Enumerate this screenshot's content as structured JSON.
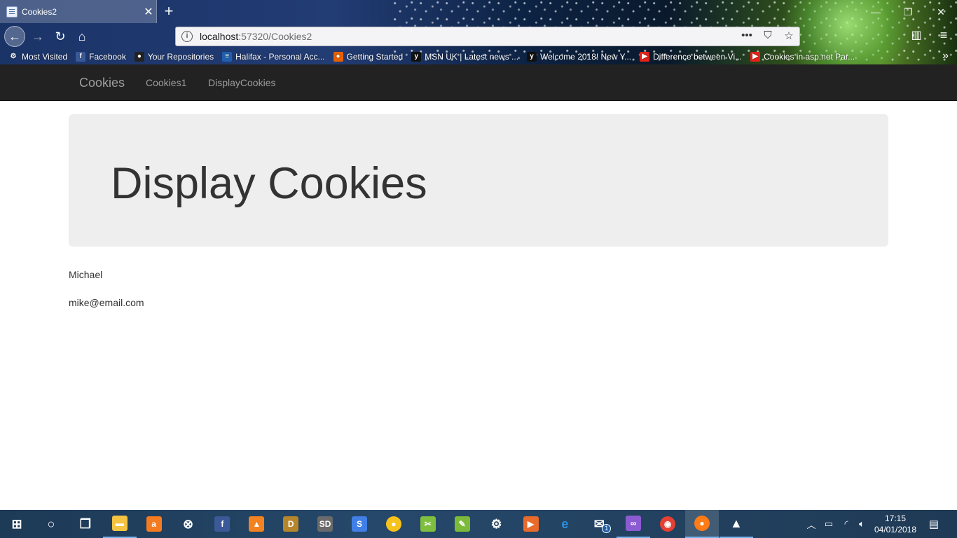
{
  "browser": {
    "tab_title": "Cookies2",
    "tab_close": "✕",
    "new_tab": "+",
    "url_host": "localhost",
    "url_path": ":57320/Cookies2",
    "window": {
      "minimize": "—",
      "restore": "❐",
      "close": "✕"
    },
    "bookmarks": [
      {
        "label": "Most Visited",
        "icon": "gear-icon",
        "color": "#ffffff"
      },
      {
        "label": "Facebook",
        "icon": "facebook-icon",
        "color": "#3b5998"
      },
      {
        "label": "Your Repositories",
        "icon": "github-icon",
        "color": "#222222"
      },
      {
        "label": "Halifax - Personal Acc...",
        "icon": "halifax-icon",
        "color": "#1f5fae"
      },
      {
        "label": "Getting Started",
        "icon": "firefox-icon",
        "color": "#e66000"
      },
      {
        "label": "MSN UK | Latest news ...",
        "icon": "msn-icon",
        "color": "#111111"
      },
      {
        "label": "Welcome 2018! New Y...",
        "icon": "yahoo-icon",
        "color": "#111111"
      },
      {
        "label": "Difference between Vi...",
        "icon": "youtube-icon",
        "color": "#e62117"
      },
      {
        "label": "Cookies in asp.net Par...",
        "icon": "youtube-icon",
        "color": "#e62117"
      }
    ]
  },
  "site": {
    "brand": "Cookies",
    "nav": [
      "Cookies1",
      "DisplayCookies"
    ],
    "heading": "Display Cookies",
    "cookie_name": "Michael",
    "cookie_email": "mike@email.com"
  },
  "taskbar": {
    "time": "17:15",
    "date": "04/01/2018",
    "mail_badge": "1",
    "apps": [
      {
        "name": "windows-start-icon",
        "color": "#ffffff"
      },
      {
        "name": "cortana-search-icon",
        "color": "#ffffff"
      },
      {
        "name": "task-view-icon",
        "color": "#ffffff"
      },
      {
        "name": "file-explorer-icon",
        "color": "#f5c342"
      },
      {
        "name": "avast-icon",
        "color": "#f47b20"
      },
      {
        "name": "xbox-icon",
        "color": "#ffffff"
      },
      {
        "name": "facebook-app-icon",
        "color": "#3b5998"
      },
      {
        "name": "vlc-icon",
        "color": "#f58220"
      },
      {
        "name": "dosbox-icon",
        "color": "#b8862a"
      },
      {
        "name": "speeddisk-icon",
        "color": "#6a6a6a"
      },
      {
        "name": "app-blue-icon",
        "color": "#3f7fe6"
      },
      {
        "name": "duck-icon",
        "color": "#f6c21b"
      },
      {
        "name": "snipping-tool-icon",
        "color": "#7fbf3f"
      },
      {
        "name": "notepad-plus-icon",
        "color": "#7cbb3a"
      },
      {
        "name": "settings-icon",
        "color": "#ffffff"
      },
      {
        "name": "media-player-icon",
        "color": "#e96b2b"
      },
      {
        "name": "edge-icon",
        "color": "#2c8fe0"
      },
      {
        "name": "mail-icon",
        "color": "#ffffff"
      },
      {
        "name": "visual-studio-icon",
        "color": "#8c5bd2"
      },
      {
        "name": "chrome-icon",
        "color": "#e44134"
      },
      {
        "name": "firefox-taskbar-icon",
        "color": "#ff7b16"
      },
      {
        "name": "photos-icon",
        "color": "#ffffff"
      }
    ]
  }
}
